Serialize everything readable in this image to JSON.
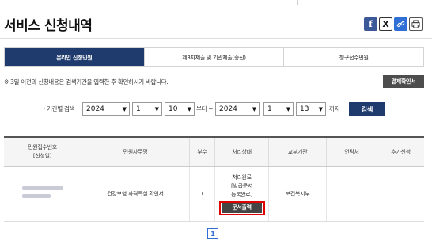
{
  "page_title": "서비스 신청내역",
  "share_icons": [
    "facebook-icon",
    "x-icon",
    "link-icon",
    "print-icon"
  ],
  "tabs": [
    {
      "label": "온라인 신청민원",
      "active": true
    },
    {
      "label": "제3자제출 및 기관제출(송신)",
      "active": false
    },
    {
      "label": "청구접수민원",
      "active": false
    }
  ],
  "notice": "※ 3일 이전의 신청내용은 검색기간을 입력한 후 확인하시기 바랍니다.",
  "confirm_button": "결제확인서",
  "filter": {
    "label": "· 기간별 검색",
    "from": {
      "year": "2024",
      "month": "1",
      "day": "10"
    },
    "from_suffix": "부터 ~",
    "to": {
      "year": "2024",
      "month": "1",
      "day": "13"
    },
    "to_suffix": "까지",
    "search_button": "검색"
  },
  "table": {
    "headers": [
      "민원접수번호\n[신청일]",
      "민원사무명",
      "부수",
      "처리상태",
      "교부기관",
      "연락처",
      "추가신청"
    ],
    "rows": [
      {
        "receipt_no": "",
        "service_name": "건강보험 자격득실 확인서",
        "copies": "1",
        "status_lines": [
          "처리완료",
          "[발급문서",
          "등록완료]"
        ],
        "print_button": "문서출력",
        "issuing_agency": "보건복지부",
        "contact": "",
        "extra": ""
      }
    ]
  },
  "pagination": {
    "current": "1"
  },
  "colors": {
    "primary": "#1f3b6d",
    "highlight": "#e00000"
  }
}
